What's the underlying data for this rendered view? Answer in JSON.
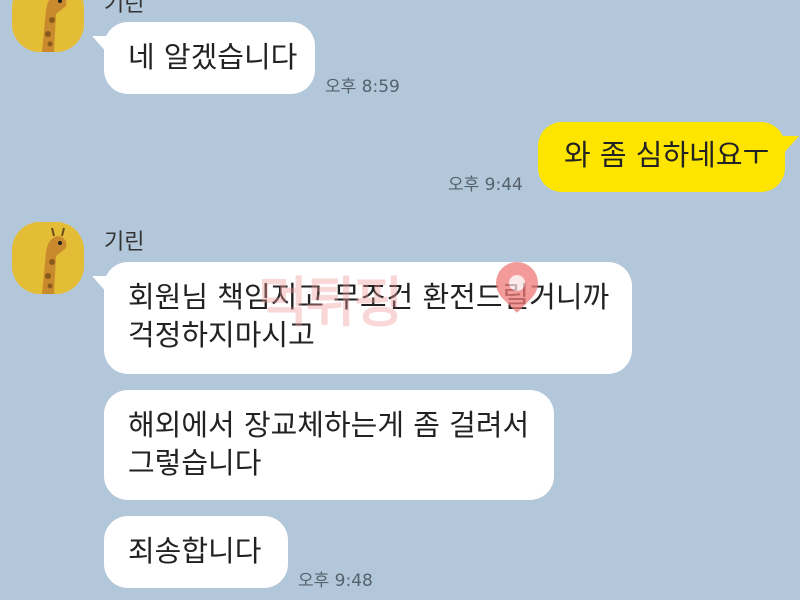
{
  "chat": {
    "messages": [
      {
        "sender": "기린",
        "direction": "in",
        "lines": [
          "네 알겠습니다"
        ],
        "time": "오후 8:59"
      },
      {
        "direction": "out",
        "lines": [
          "와 좀 심하네요ㅜ"
        ],
        "time": "오후 9:44"
      },
      {
        "sender": "기린",
        "direction": "in",
        "lines": [
          "회원님 책임지고 무조건 환전드릴거니까",
          "걱정하지마시고"
        ]
      },
      {
        "direction": "in",
        "lines": [
          "해외에서 장교체하는게 좀 걸려서",
          "그렇습니다"
        ]
      },
      {
        "direction": "in",
        "lines": [
          "죄송합니다"
        ],
        "time": "오후 9:48"
      }
    ]
  },
  "watermark": {
    "text": "먹튀핑"
  },
  "icons": {
    "avatar": "giraffe-avatar-icon",
    "pin": "location-pin-icon"
  },
  "colors": {
    "background": "#b2c7d9",
    "incoming_bubble": "#ffffff",
    "outgoing_bubble": "#fee500"
  }
}
